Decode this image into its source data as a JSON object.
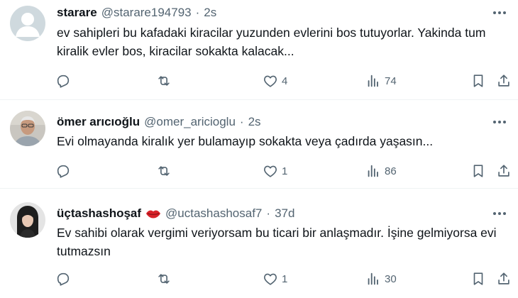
{
  "tweets": [
    {
      "name": "starare",
      "handle": "@starare194793",
      "time": "2s",
      "text": "ev sahipleri bu kafadaki kiracilar yuzunden evlerini bos tutuyorlar. Yakinda tum kiralik evler bos, kiracilar sokakta kalacak...",
      "reply_count": "",
      "repost_count": "",
      "like_count": "4",
      "view_count": "74",
      "avatar": "default-avatar"
    },
    {
      "name": "ömer arıcıoğlu",
      "handle": "@omer_aricioglu",
      "time": "2s",
      "text": "Evi olmayanda kiralık yer bulamayıp sokakta veya çadırda yaşasın...",
      "reply_count": "",
      "repost_count": "",
      "like_count": "1",
      "view_count": "86",
      "avatar": "photo-man-glasses"
    },
    {
      "name": "üçtashashoşaf",
      "handle": "@uctashashosaf7",
      "time": "37d",
      "text": "Ev sahibi olarak vergimi veriyorsam bu ticari bir anlaşmadır. İşine gelmiyorsa evi tutmazsın",
      "reply_count": "",
      "repost_count": "",
      "like_count": "1",
      "view_count": "30",
      "avatar": "photo-woman",
      "name_emoji": "lips-emoji"
    }
  ],
  "colors": {
    "text": "#0f1419",
    "secondary": "#536471",
    "divider": "#eff3f4",
    "default_avatar_bg": "#cfd9de",
    "emoji_red": "#d8232a"
  }
}
